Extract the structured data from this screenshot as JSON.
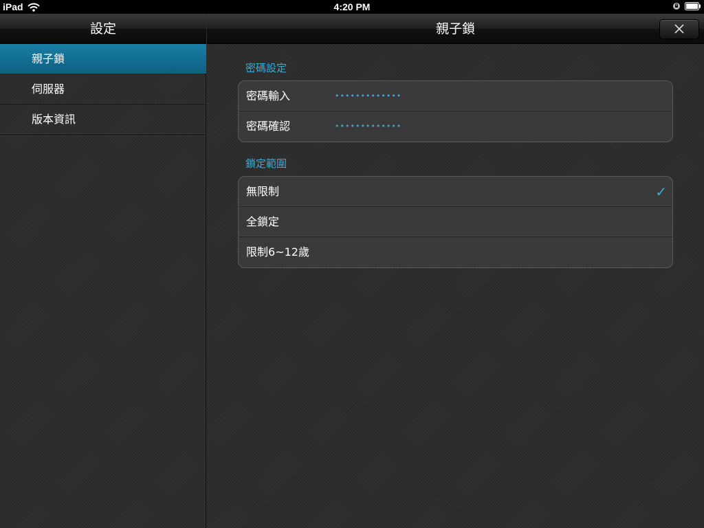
{
  "status_bar": {
    "device": "iPad",
    "time": "4:20 PM"
  },
  "master": {
    "title": "設定",
    "items": [
      {
        "label": "親子鎖",
        "selected": true
      },
      {
        "label": "伺服器",
        "selected": false
      },
      {
        "label": "版本資訊",
        "selected": false
      }
    ]
  },
  "detail": {
    "title": "親子鎖",
    "password_section": {
      "header": "密碼設定",
      "rows": [
        {
          "label": "密碼輸入",
          "value": "•••••••••••••"
        },
        {
          "label": "密碼確認",
          "value": "•••••••••••••"
        }
      ]
    },
    "lock_section": {
      "header": "鎖定範圍",
      "rows": [
        {
          "label": "無限制",
          "checked": true
        },
        {
          "label": "全鎖定",
          "checked": false
        },
        {
          "label": "限制6~12歲",
          "checked": false
        }
      ]
    }
  },
  "colors": {
    "accent": "#3fa9d6",
    "selected_row": "#1a7ea5"
  },
  "icons": [
    "wifi-icon",
    "lock-rotation-icon",
    "battery-icon",
    "close-icon",
    "checkmark-icon"
  ]
}
